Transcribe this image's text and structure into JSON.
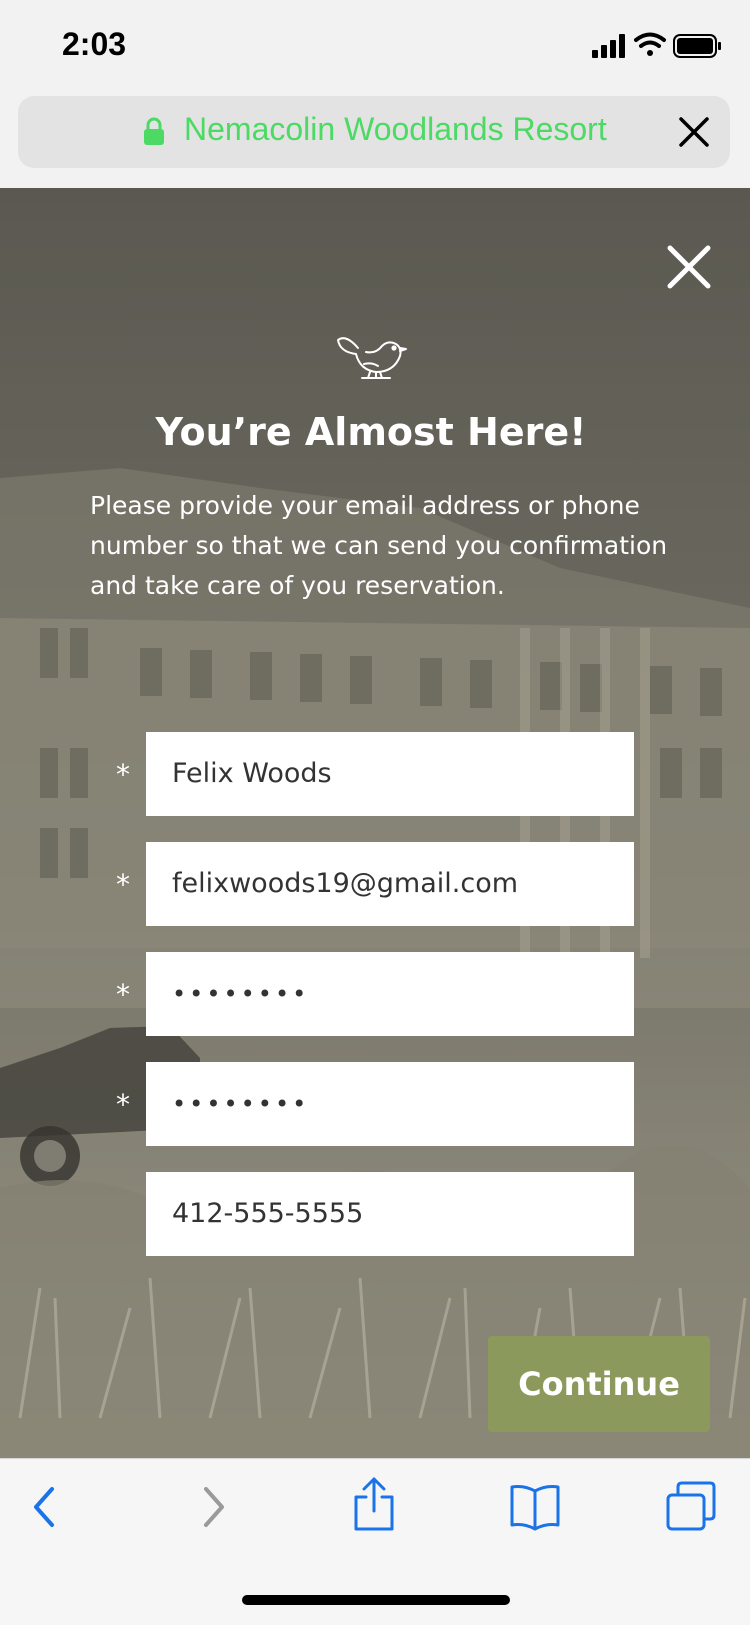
{
  "status_bar": {
    "time": "2:03"
  },
  "browser": {
    "url_title": "Nemacolin Woodlands Resort",
    "url_color": "#4cd964"
  },
  "modal": {
    "title": "You’re Almost Here!",
    "description": "Please provide your email address or phone number so that we can send you confirmation and  take care of you reservation.",
    "fields": [
      {
        "required": true,
        "required_mark": "*",
        "value": "Felix Woods"
      },
      {
        "required": true,
        "required_mark": "*",
        "value": "felixwoods19@gmail.com"
      },
      {
        "required": true,
        "required_mark": "*",
        "value": "••••••••"
      },
      {
        "required": true,
        "required_mark": "*",
        "value": "••••••••"
      },
      {
        "required": false,
        "required_mark": "",
        "value": "412-555-5555"
      }
    ],
    "continue_label": "Continue",
    "continue_color": "#8b9a5c"
  },
  "toolbar": {
    "icons": [
      "back-icon",
      "forward-icon",
      "share-icon",
      "bookmarks-icon",
      "tabs-icon"
    ],
    "accent": "#1a73e8"
  }
}
